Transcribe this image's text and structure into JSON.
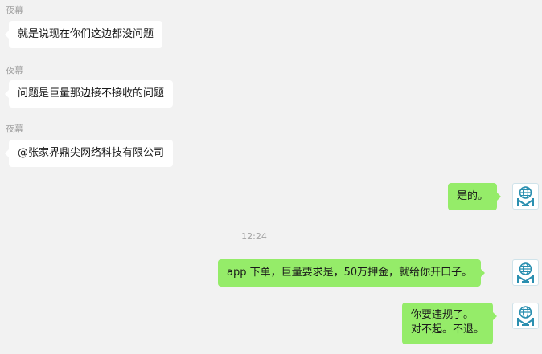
{
  "messages": [
    {
      "sender": "夜幕",
      "text": "就是说现在你们这边都没问题"
    },
    {
      "sender": "夜幕",
      "text": "问题是巨量那边接不接收的问题"
    },
    {
      "sender": "夜幕",
      "text": "@张家界鼎尖网络科技有限公司"
    },
    {
      "text": "是的。"
    },
    {
      "timestamp": "12:24"
    },
    {
      "text": "app 下单，巨量要求是，50万押金，就给你开口子。"
    },
    {
      "lines": [
        "你要违规了。",
        "对不起。不退。"
      ]
    }
  ],
  "colors": {
    "background": "#f2f2f2",
    "incoming_bubble": "#ffffff",
    "outgoing_bubble": "#95ec69",
    "meta_text": "#a3a3a3",
    "avatar_accent": "#2a8fb0"
  },
  "avatar_icon": "globe-building-logo-icon"
}
